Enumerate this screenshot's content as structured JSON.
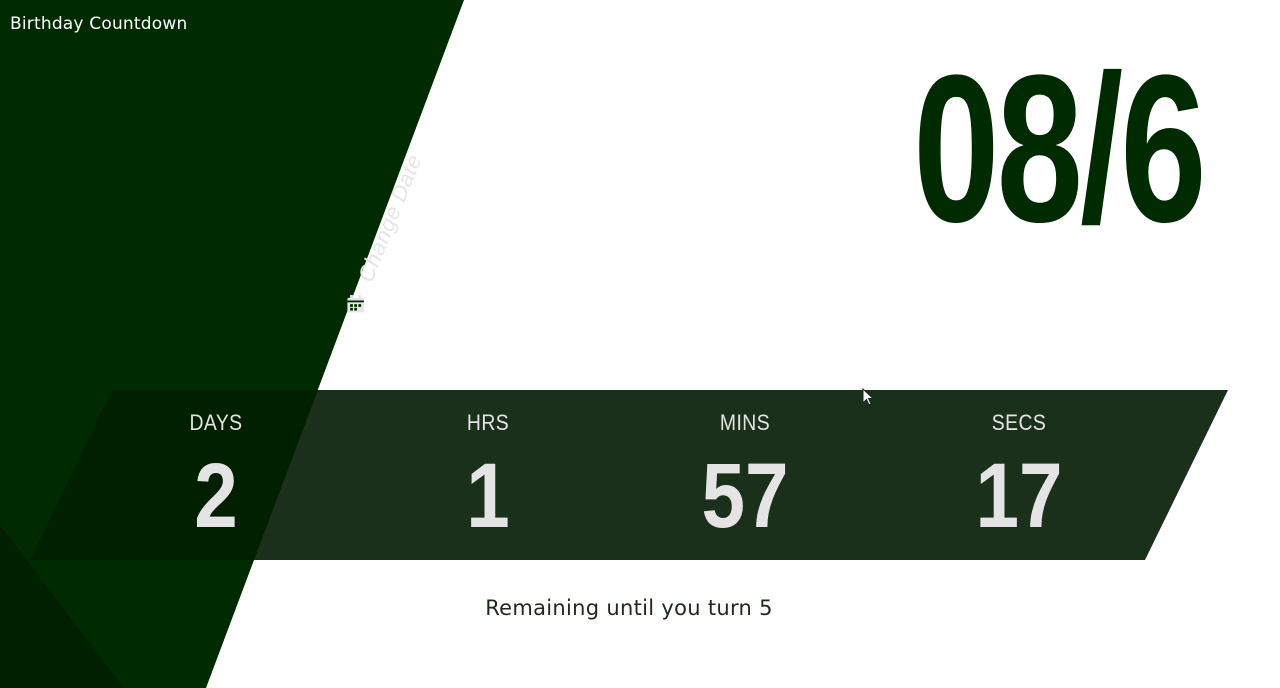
{
  "app": {
    "title": "Birthday Countdown"
  },
  "change_date": {
    "label": "Change Date",
    "icon": "calendar-icon"
  },
  "target_date": "08/6",
  "countdown": {
    "days": {
      "label": "DAYS",
      "value": "2"
    },
    "hours": {
      "label": "HRS",
      "value": "1"
    },
    "minutes": {
      "label": "MINS",
      "value": "57"
    },
    "seconds": {
      "label": "SECS",
      "value": "17"
    }
  },
  "remaining_text": "Remaining until you turn 5",
  "colors": {
    "dark_green": "#002a00",
    "band_green": "#1b301b",
    "band_overlap": "#012000",
    "text_light": "#e4e4e4",
    "background": "#ffffff"
  }
}
